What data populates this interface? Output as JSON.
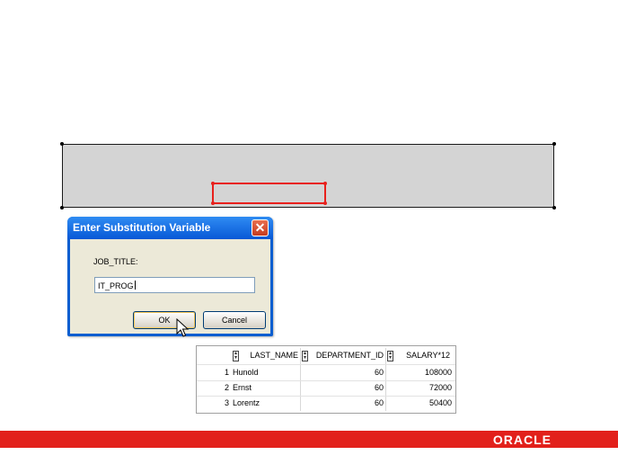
{
  "dialog": {
    "title": "Enter Substitution Variable",
    "close_symbol": "✕",
    "field_label": "JOB_TITLE:",
    "field_value": "IT_PROG",
    "ok_label": "OK",
    "cancel_label": "Cancel"
  },
  "grid": {
    "columns": [
      "LAST_NAME",
      "DEPARTMENT_ID",
      "SALARY*12"
    ],
    "rows": [
      {
        "num": "1",
        "last_name": "Hunold",
        "department_id": "60",
        "salary": "108000"
      },
      {
        "num": "2",
        "last_name": "Ernst",
        "department_id": "60",
        "salary": "72000"
      },
      {
        "num": "3",
        "last_name": "Lorentz",
        "department_id": "60",
        "salary": "50400"
      }
    ]
  },
  "footer": {
    "logo_text": "ORACLE"
  },
  "colors": {
    "accent_red": "#e2201b",
    "dialog_blue": "#0a5ed0",
    "panel_gray": "#d4d4d4"
  }
}
